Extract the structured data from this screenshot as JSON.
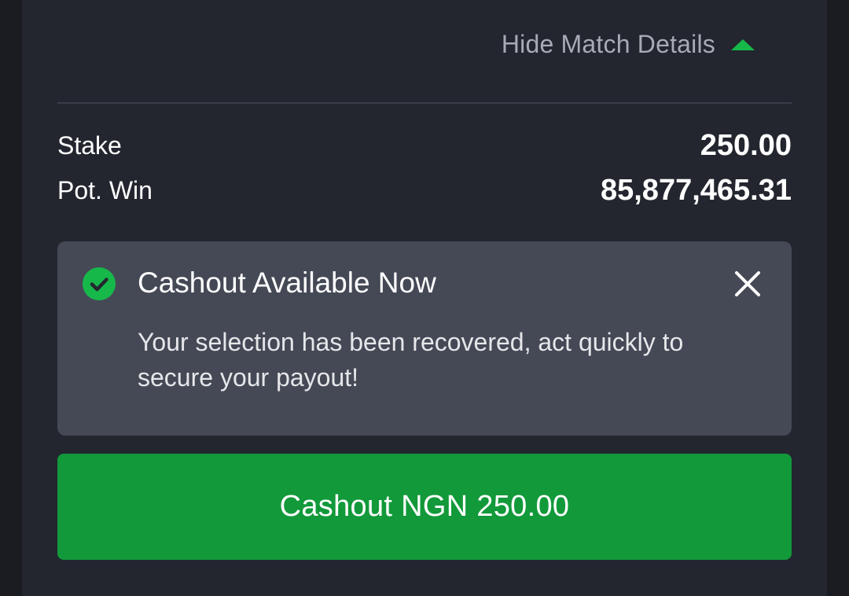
{
  "header": {
    "toggle_label": "Hide Match Details",
    "toggle_icon": "caret-up-icon"
  },
  "summary": {
    "stake_label": "Stake",
    "stake_value": "250.00",
    "pot_win_label": "Pot. Win",
    "pot_win_value": "85,877,465.31"
  },
  "notice": {
    "icon": "check-circle-icon",
    "title": "Cashout Available Now",
    "message": "Your selection has been recovered, act quickly to secure your payout!",
    "close_icon": "close-icon"
  },
  "cashout": {
    "button_label": "Cashout NGN 250.00"
  },
  "colors": {
    "page_bg": "#1a1c22",
    "card_bg": "#23262f",
    "notice_bg": "#454956",
    "accent_green": "#17b84a",
    "button_green": "#12993a",
    "muted_text": "#a7abb5"
  }
}
